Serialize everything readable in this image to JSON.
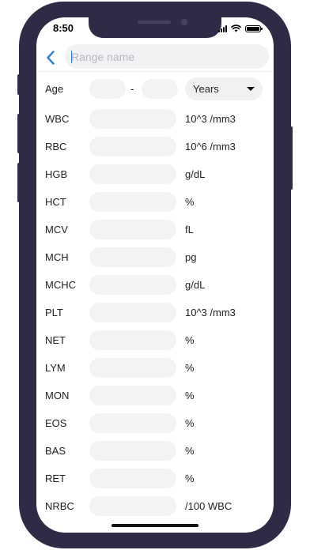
{
  "status_bar": {
    "time": "8:50"
  },
  "search": {
    "placeholder": "Range name"
  },
  "age_row": {
    "label": "Age",
    "separator": "-",
    "unit_selected": "Years"
  },
  "rows": [
    {
      "label": "WBC",
      "unit": "10^3 /mm3"
    },
    {
      "label": "RBC",
      "unit": "10^6 /mm3"
    },
    {
      "label": "HGB",
      "unit": "g/dL"
    },
    {
      "label": "HCT",
      "unit": "%"
    },
    {
      "label": "MCV",
      "unit": "fL"
    },
    {
      "label": "MCH",
      "unit": "pg"
    },
    {
      "label": "MCHC",
      "unit": "g/dL"
    },
    {
      "label": "PLT",
      "unit": "10^3 /mm3"
    },
    {
      "label": "NET",
      "unit": "%"
    },
    {
      "label": "LYM",
      "unit": "%"
    },
    {
      "label": "MON",
      "unit": "%"
    },
    {
      "label": "EOS",
      "unit": "%"
    },
    {
      "label": "BAS",
      "unit": "%"
    },
    {
      "label": "RET",
      "unit": "%"
    },
    {
      "label": "NRBC",
      "unit": "/100 WBC"
    }
  ],
  "colors": {
    "frame": "#2d2b45",
    "accent": "#2f7fd4",
    "field": "#f3f3f5"
  }
}
